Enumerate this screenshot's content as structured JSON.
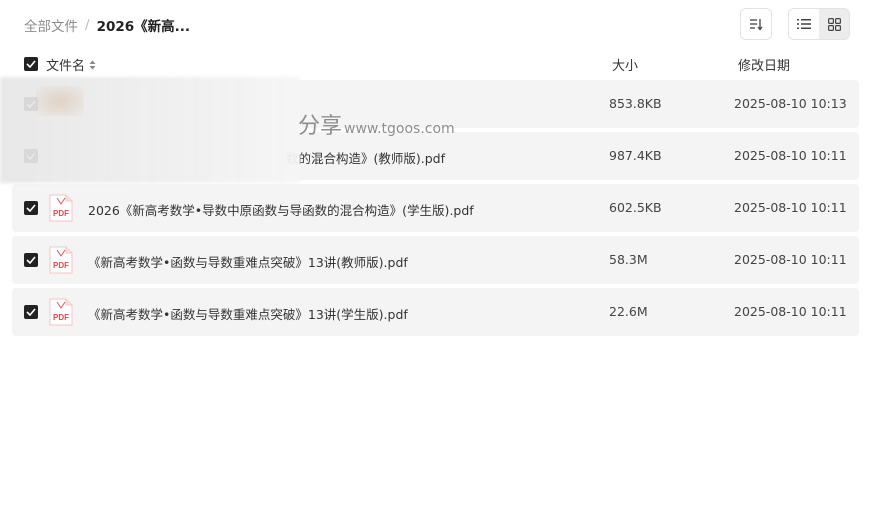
{
  "breadcrumb": {
    "root": "全部文件",
    "separator": "/",
    "current": "2026《新高..."
  },
  "toolbar": {
    "sort_icon": "sort-icon",
    "list_view_icon": "list-view-icon",
    "grid_view_icon": "grid-view-icon"
  },
  "table": {
    "headers": {
      "name": "文件名",
      "size": "大小",
      "date": "修改日期"
    },
    "rows": [
      {
        "name": "",
        "size": "853.8KB",
        "date": "2025-08-10 10:13",
        "checked": true
      },
      {
        "name": "数的混合构造》(教师版).pdf",
        "size": "987.4KB",
        "date": "2025-08-10 10:11",
        "checked": true
      },
      {
        "name": "2026《新高考数学•导数中原函数与导函数的混合构造》(学生版).pdf",
        "size": "602.5KB",
        "date": "2025-08-10 10:11",
        "checked": true
      },
      {
        "name": "《新高考数学•函数与导数重难点突破》13讲(教师版).pdf",
        "size": "58.3M",
        "date": "2025-08-10 10:11",
        "checked": true
      },
      {
        "name": "《新高考数学•函数与导数重难点突破》13讲(学生版).pdf",
        "size": "22.6M",
        "date": "2025-08-10 10:11",
        "checked": true
      }
    ]
  },
  "watermark": {
    "text": "分享",
    "url": "www.tgoos.com"
  },
  "colors": {
    "row_bg": "#f4f4f4",
    "checkbox": "#222222",
    "pdf_red": "#e5484d"
  }
}
